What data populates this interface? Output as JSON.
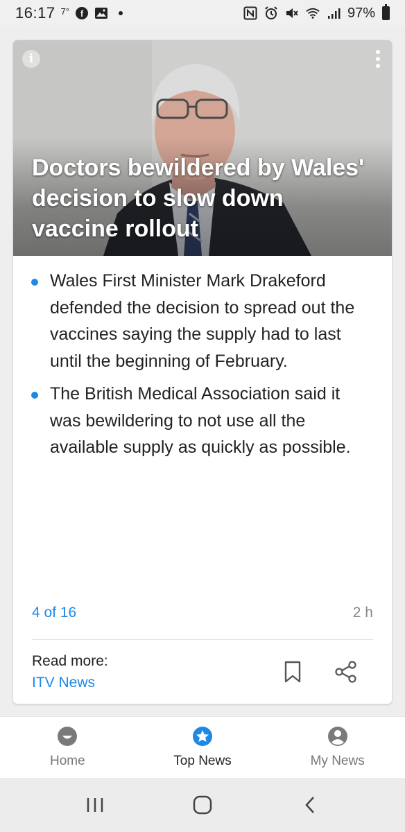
{
  "status_bar": {
    "time": "16:17",
    "temperature": "7°",
    "battery": "97%",
    "icons": [
      "facebook-icon",
      "gallery-icon",
      "dot-icon",
      "nfc-icon",
      "alarm-icon",
      "mute-icon",
      "wifi-icon",
      "signal-icon",
      "battery-icon"
    ]
  },
  "article": {
    "title": "Doctors bewildered by Wales' decision to slow down vaccine rollout",
    "bullets": [
      "Wales First Minister Mark Drakeford defended the decision to spread out the vaccines saying the supply had to last until the beginning of February.",
      "The British Medical Association said it was bewildering to not use all the available supply as quickly as possible."
    ],
    "position": "4 of 16",
    "age": "2 h",
    "read_more_label": "Read more:",
    "source": "ITV News"
  },
  "bottom_nav": {
    "items": [
      {
        "label": "Home",
        "icon": "home-smile-icon",
        "active": false
      },
      {
        "label": "Top News",
        "icon": "star-badge-icon",
        "active": true
      },
      {
        "label": "My News",
        "icon": "person-icon",
        "active": false
      }
    ]
  },
  "colors": {
    "accent": "#1e88e5",
    "text": "#222222",
    "muted": "#777777"
  }
}
